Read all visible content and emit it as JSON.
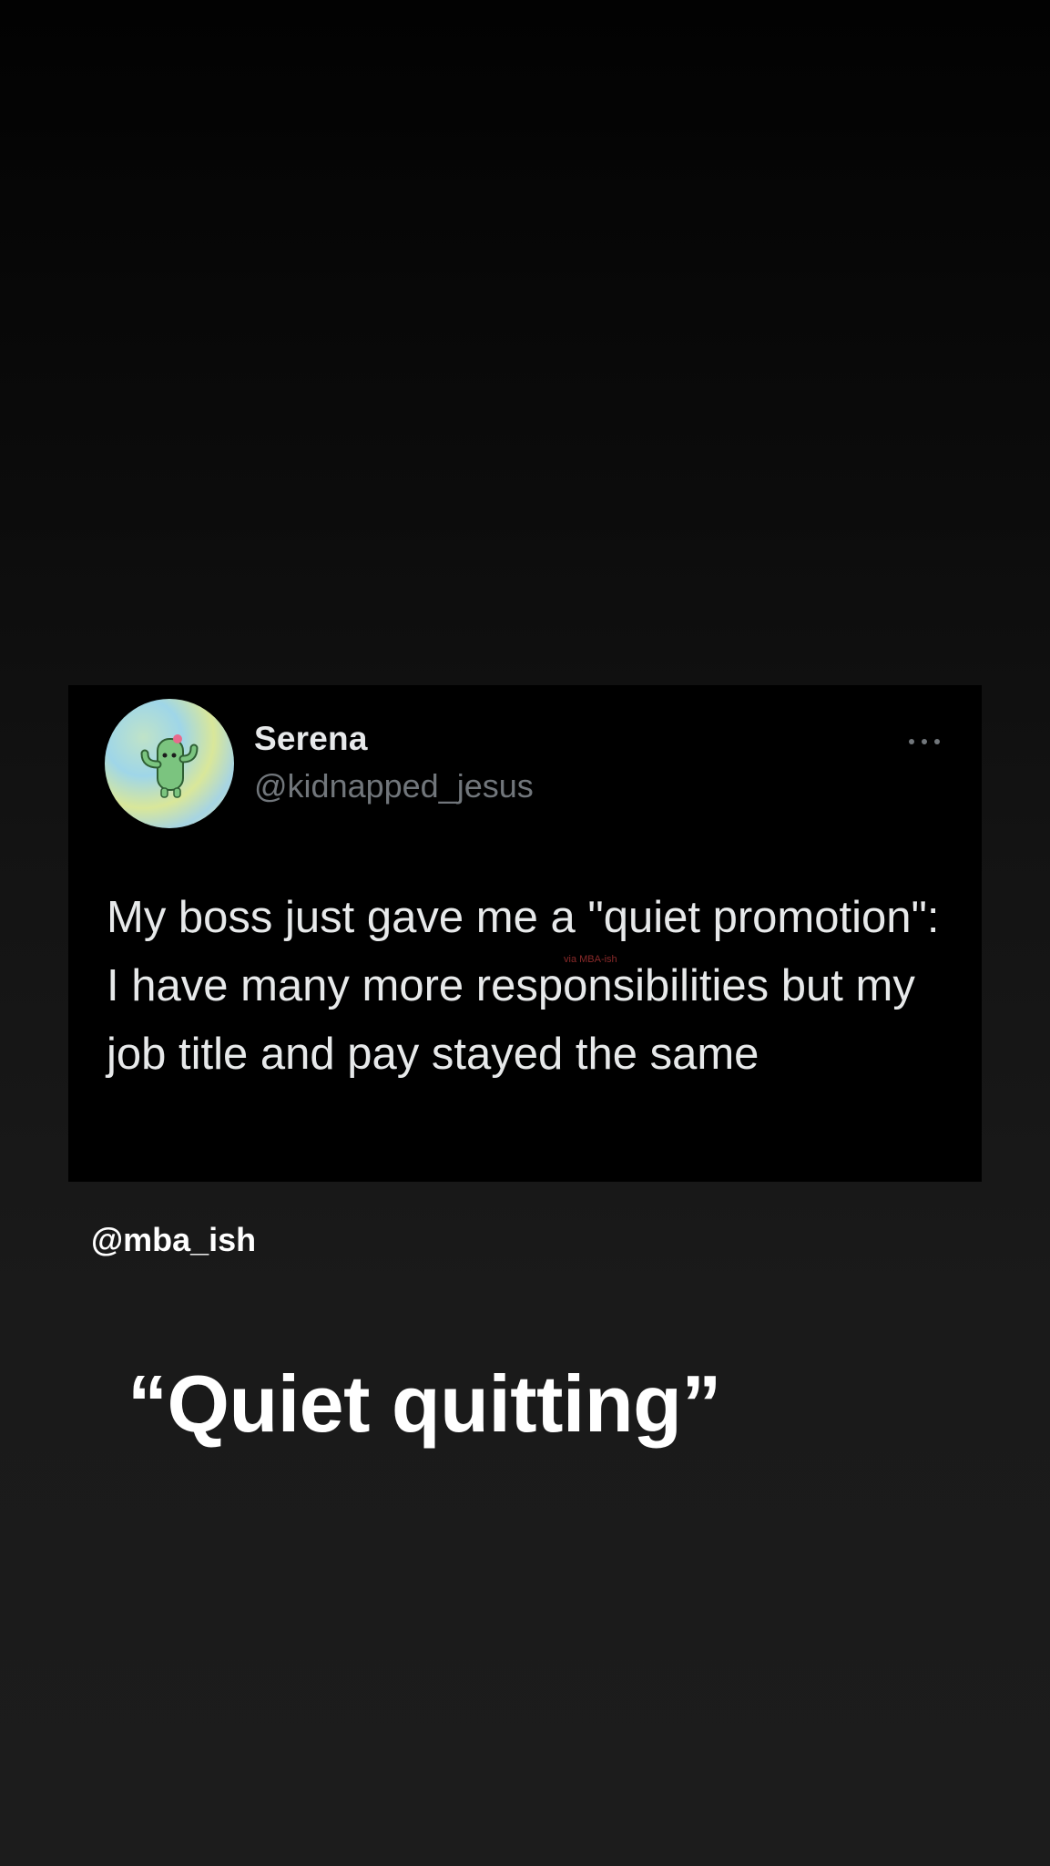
{
  "tweet": {
    "display_name": "Serena",
    "handle": "@kidnapped_jesus",
    "text": "My boss just gave me a \"quiet promotion\": I have many more responsibilities but my job title and pay stayed the same",
    "watermark": "via MBA-ish",
    "avatar_icon": "cactus-avatar-icon",
    "more_icon": "more-options-icon"
  },
  "credit": "@mba_ish",
  "headline": "“Quiet quitting”",
  "colors": {
    "card_background": "#000000",
    "name_text": "#e7e9ea",
    "handle_text": "#71767b",
    "headline_text": "#ffffff"
  }
}
